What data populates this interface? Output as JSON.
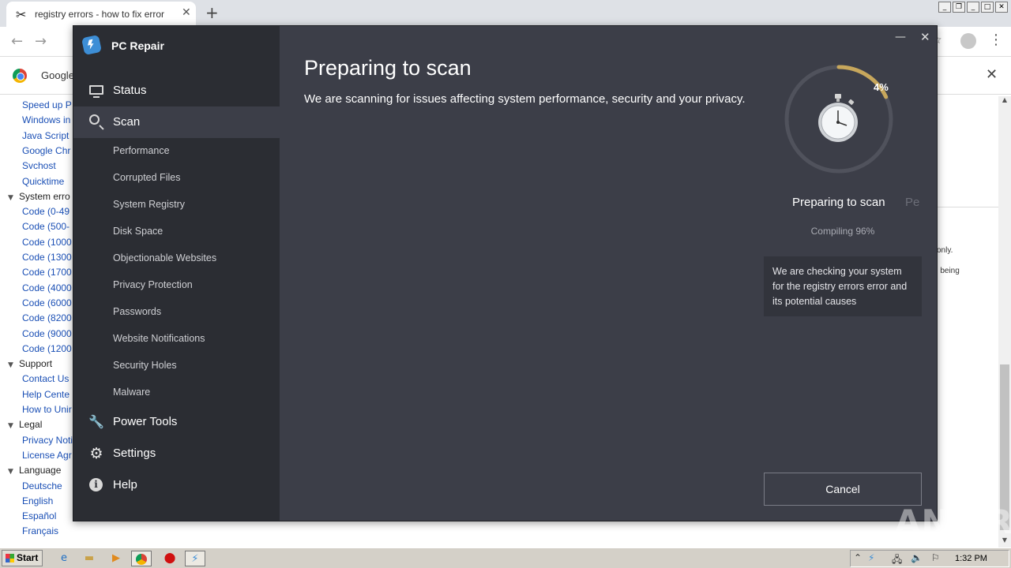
{
  "browser": {
    "tab_title": "registry errors - how to fix error",
    "tab_icon": "scissors-icon",
    "infobar_text": "Google",
    "sidebar_items": [
      {
        "kind": "link",
        "label": "Speed up P"
      },
      {
        "kind": "link",
        "label": "Windows in"
      },
      {
        "kind": "link",
        "label": "Java Script"
      },
      {
        "kind": "link",
        "label": "Google Chr"
      },
      {
        "kind": "link",
        "label": "Svchost"
      },
      {
        "kind": "link",
        "label": "Quicktime"
      },
      {
        "kind": "head",
        "label": "System erro"
      },
      {
        "kind": "link",
        "label": "Code (0-49"
      },
      {
        "kind": "link",
        "label": "Code (500-"
      },
      {
        "kind": "link",
        "label": "Code (1000"
      },
      {
        "kind": "link",
        "label": "Code (1300"
      },
      {
        "kind": "link",
        "label": "Code (1700"
      },
      {
        "kind": "link",
        "label": "Code (4000"
      },
      {
        "kind": "link",
        "label": "Code (6000"
      },
      {
        "kind": "link",
        "label": "Code (8200"
      },
      {
        "kind": "link",
        "label": "Code (9000"
      },
      {
        "kind": "link",
        "label": "Code (1200"
      },
      {
        "kind": "head",
        "label": "Support"
      },
      {
        "kind": "link",
        "label": "Contact Us"
      },
      {
        "kind": "link",
        "label": "Help Cente"
      },
      {
        "kind": "link",
        "label": "How to Unir"
      },
      {
        "kind": "head",
        "label": "Legal"
      },
      {
        "kind": "link",
        "label": "Privacy Noti"
      },
      {
        "kind": "link",
        "label": "License Agr"
      },
      {
        "kind": "head",
        "label": "Language"
      },
      {
        "kind": "link",
        "label": "Deutsche"
      },
      {
        "kind": "link",
        "label": "English"
      },
      {
        "kind": "link",
        "label": "Español"
      },
      {
        "kind": "link",
        "label": "Français"
      }
    ],
    "right_text_1": "only.",
    "right_text_2": "n being"
  },
  "app": {
    "title": "PC Repair",
    "nav": [
      {
        "label": "Status",
        "icon": "monitor-icon"
      },
      {
        "label": "Scan",
        "icon": "search-icon",
        "active": true
      },
      {
        "label": "Power Tools",
        "icon": "wrench-icon"
      },
      {
        "label": "Settings",
        "icon": "gear-icon"
      },
      {
        "label": "Help",
        "icon": "info-icon"
      }
    ],
    "scan_subitems": [
      "Performance",
      "Corrupted Files",
      "System Registry",
      "Disk Space",
      "Objectionable Websites",
      "Privacy Protection",
      "Passwords",
      "Website Notifications",
      "Security Holes",
      "Malware"
    ],
    "main_title": "Preparing to scan",
    "main_desc": "We are scanning for issues affecting system performance, security and your privacy.",
    "progress": {
      "percent_label": "4%",
      "fraction": 0.04
    },
    "status_current": "Preparing to scan",
    "status_next": "Pe",
    "compiling": "Compiling 96%",
    "info_box": "We are checking your system for the registry errors error and its potential causes",
    "cancel_label": "Cancel",
    "watermark": "ANY RUN",
    "colors": {
      "bg": "#3c3e48",
      "sidebar": "#2b2d33",
      "progress": "#c7a75c"
    }
  },
  "taskbar": {
    "start_label": "Start",
    "clock": "1:32 PM"
  }
}
